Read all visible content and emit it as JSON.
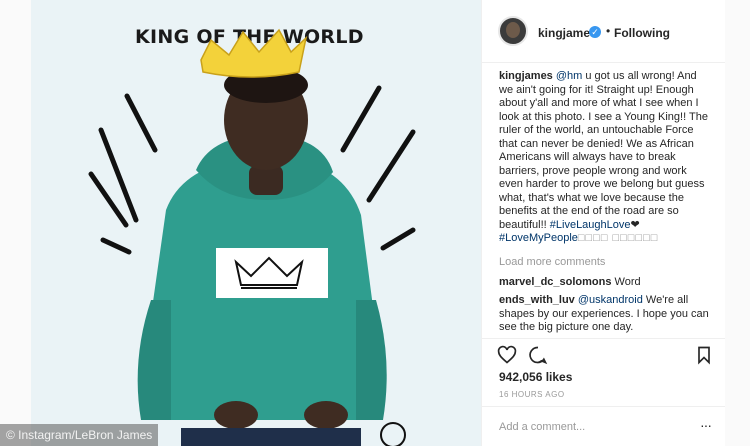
{
  "image": {
    "headline": "KING OF THE WORLD",
    "watermark": "© Instagram/LeBron James"
  },
  "post": {
    "username": "kingjames",
    "verified_icon": "verified-badge-icon",
    "separator": "•",
    "follow_label": "Following",
    "caption_user": "kingjames",
    "caption_mention": "@hm",
    "caption_text": " u got us all wrong! And we ain't going for it! Straight up! Enough about y'all and more of what I see when I look at this photo. I see a Young King!! The ruler of the world, an untouchable Force that can never be denied! We as African Americans will always have to break barriers, prove people wrong and work even harder to prove we belong but guess what, that's what we love because the benefits at the end of the road are so beautiful!! ",
    "hashtag1": "#LiveLaughLove",
    "heart_emoji": "❤",
    "hashtag2": "#LoveMyPeople",
    "emoji_boxes": "□□□□ □□□□□□",
    "load_more": "Load more comments",
    "comments": [
      {
        "user": "marvel_dc_solomons",
        "text": " Word"
      },
      {
        "user": "ends_with_luv",
        "mention": "@uskandroid",
        "text": " We're all shapes by our experiences. I hope you can see the big picture one day."
      }
    ],
    "likes": "942,056 likes",
    "time": "16 HOURS AGO",
    "comment_placeholder": "Add a comment...",
    "options": "···"
  },
  "colors": {
    "accent_link": "#003569",
    "verified": "#3897f0",
    "hoodie": "#2f9e8f",
    "crown": "#f3d23a"
  }
}
